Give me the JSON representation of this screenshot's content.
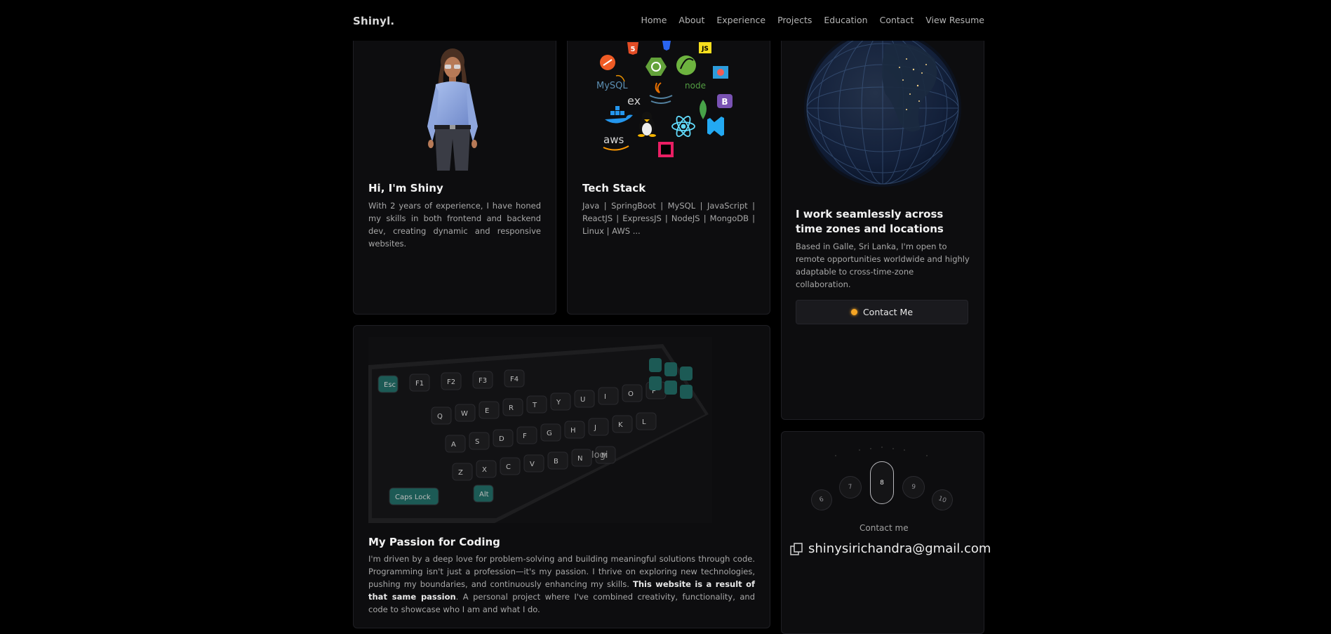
{
  "nav": {
    "logo": "Shinyl.",
    "items": [
      "Home",
      "About",
      "Experience",
      "Projects",
      "Education",
      "Contact",
      "View Resume"
    ]
  },
  "intro": {
    "title": "Hi, I'm Shiny",
    "text": "With 2 years of experience, I have honed my skills in both frontend and backend dev, creating dynamic and responsive websites."
  },
  "tech": {
    "title": "Tech Stack",
    "text": "Java | SpringBoot | MySQL | JavaScript | ReactJS | ExpressJS | NodeJS | MongoDB | Linux | AWS ...",
    "logo_labels": [
      "JS",
      "MySQL",
      "ex",
      "node",
      "B",
      "aws"
    ]
  },
  "globe": {
    "title": "I work seamlessly across time zones and locations",
    "text": "Based in Galle, Sri Lanka, I'm open to remote opportunities worldwide and highly adaptable to cross-time-zone collaboration.",
    "button": "Contact Me"
  },
  "coding": {
    "title": "My Passion for Coding",
    "text_before": "I'm driven by a deep love for problem-solving and building meaningful solutions through code. Programming isn't just a profession—it's my passion. I thrive on exploring new technologies, pushing my boundaries, and continuously enhancing my skills. ",
    "text_bold": "This website is a result of that same passion",
    "text_after": ". A personal project where I've combined creativity, functionality, and code to showcase who I am and what I do."
  },
  "keyboard": {
    "brand": "logi",
    "keys": [
      "Esc",
      "F1",
      "F2",
      "F3",
      "F4",
      "Q",
      "W",
      "E",
      "R",
      "T",
      "Y",
      "U",
      "I",
      "O",
      "P",
      "A",
      "S",
      "D",
      "F",
      "G",
      "H",
      "J",
      "K",
      "L",
      "Z",
      "X",
      "C",
      "V",
      "B",
      "N",
      "M",
      "Caps Lock",
      "Alt"
    ]
  },
  "dial": {
    "numbers": [
      "6",
      "7",
      "8",
      "9",
      "10"
    ],
    "selected": "8"
  },
  "contact": {
    "label": "Contact me",
    "email": "shinysirichandra@gmail.com"
  },
  "colors": {
    "background": "#000000",
    "card": "#0d0d0f",
    "accent_orange": "#f5a524"
  }
}
